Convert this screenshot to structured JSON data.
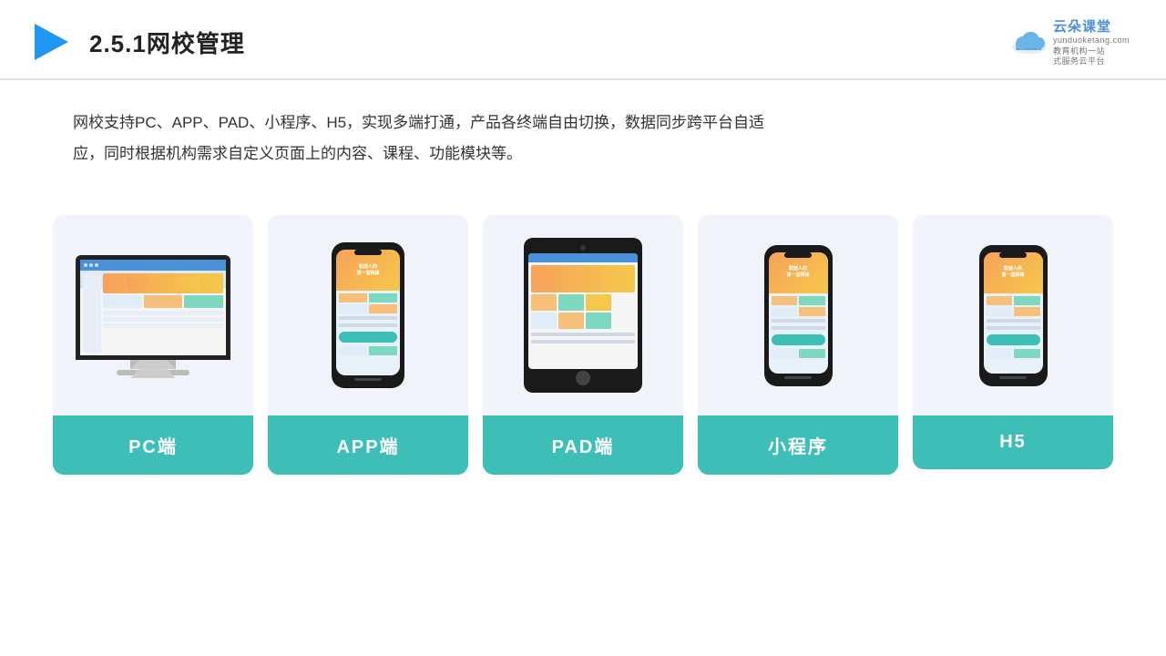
{
  "header": {
    "title": "2.5.1网校管理",
    "logo": {
      "brand": "云朵课堂",
      "url": "yunduoketang.com",
      "tagline1": "教育机构一站",
      "tagline2": "式服务云平台"
    }
  },
  "description": {
    "text": "网校支持PC、APP、PAD、小程序、H5，实现多端打通，产品各终端自由切换，数据同步跨平台自适应，同时根据机构需求自定义页面上的内容、课程、功能模块等。"
  },
  "cards": [
    {
      "id": "pc",
      "label": "PC端"
    },
    {
      "id": "app",
      "label": "APP端"
    },
    {
      "id": "pad",
      "label": "PAD端"
    },
    {
      "id": "miniprogram",
      "label": "小程序"
    },
    {
      "id": "h5",
      "label": "H5"
    }
  ]
}
